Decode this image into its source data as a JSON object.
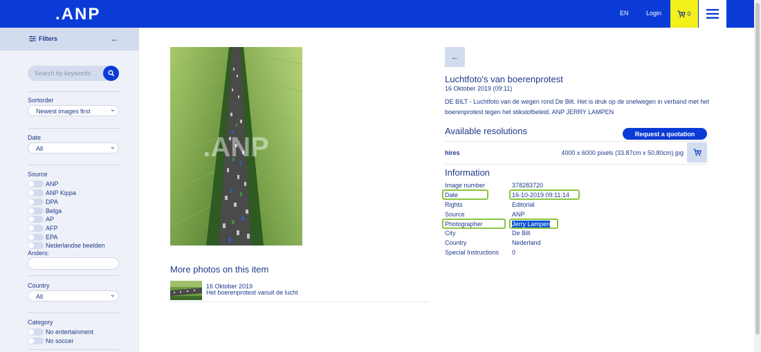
{
  "header": {
    "logo": ".ANP",
    "lang": "EN",
    "login": "Login",
    "cart_count": "0",
    "brand_color": "#0b3bd6",
    "cart_color": "#f3f01a"
  },
  "sidebar": {
    "filters_label": "Filters",
    "search_placeholder": "Search by keywords",
    "sortorder": {
      "label": "Sortorder",
      "value": "Newest images first"
    },
    "date": {
      "label": "Date",
      "value": "All"
    },
    "source": {
      "label": "Source",
      "options": [
        "ANP",
        "ANP Kippa",
        "DPA",
        "Belga",
        "AP",
        "AFP",
        "EPA",
        "Nederlandse beelden"
      ],
      "other_label": "Anders:"
    },
    "country": {
      "label": "Country",
      "value": "All"
    },
    "category": {
      "label": "Category",
      "options": [
        "No entertainment",
        "No soccer"
      ]
    }
  },
  "photo": {
    "watermark": ".ANP"
  },
  "more": {
    "title": "More photos on this item",
    "items": [
      {
        "date": "16 Oktober 2019",
        "caption": "Het boerenprotest vanuit de lucht"
      }
    ]
  },
  "detail": {
    "title": "Luchtfoto's van boerenprotest",
    "datetime": "16 Oktober 2019 (09:11)",
    "description": "DE BILT - Luchtfoto van de wegen rond De Bilt. Het is druk op de snelwegen in verband met het boerenprotest tegen het stikstofbeleid. ANP JERRY LAMPEN",
    "resolutions": {
      "title": "Available resolutions",
      "quote_button": "Request a quotation",
      "items": [
        {
          "name": "hires",
          "size": "4000 x 6000 pixels (33.87cm x 50.80cm)  jpg"
        }
      ]
    },
    "information": {
      "title": "Information",
      "rows": [
        {
          "key": "Image number",
          "value": "378283720"
        },
        {
          "key": "Date",
          "value": "16-10-2019 09:11:14"
        },
        {
          "key": "Rights",
          "value": "Editorial"
        },
        {
          "key": "Source",
          "value": "ANP"
        },
        {
          "key": "Photographer",
          "value": "Jerry Lampen"
        },
        {
          "key": "City",
          "value": "De Bilt"
        },
        {
          "key": "Country",
          "value": "Nederland"
        },
        {
          "key": "Special Instructions",
          "value": "0"
        }
      ]
    },
    "highlight_color": "#8ac43f"
  }
}
